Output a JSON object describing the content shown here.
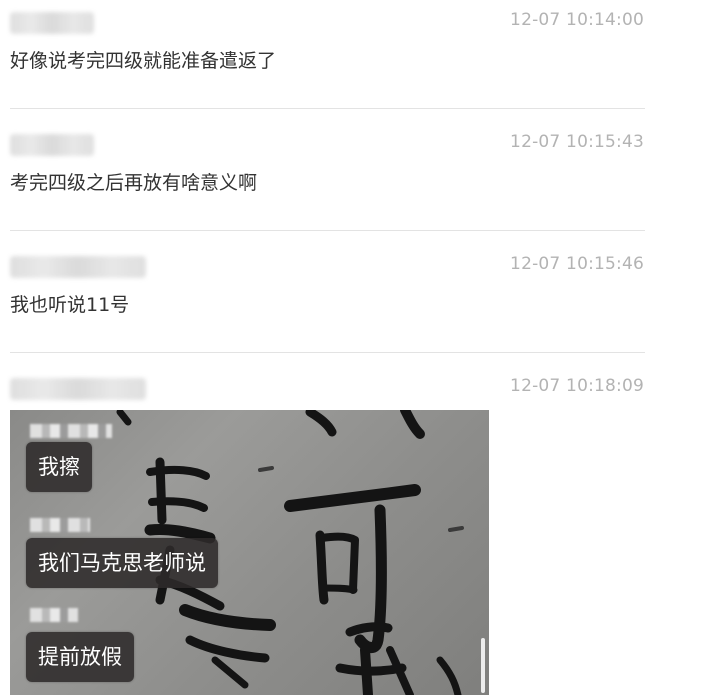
{
  "comments": [
    {
      "time": "12-07 10:14:00",
      "text": "好像说考完四级就能准备遣返了"
    },
    {
      "time": "12-07 10:15:43",
      "text": "考完四级之后再放有啥意义啊"
    },
    {
      "time": "12-07 10:15:46",
      "text": "我也听说11号"
    },
    {
      "time": "12-07 10:18:09",
      "text": ""
    }
  ],
  "image_bubbles": [
    "我擦",
    "我们马克思老师说",
    "提前放假"
  ]
}
